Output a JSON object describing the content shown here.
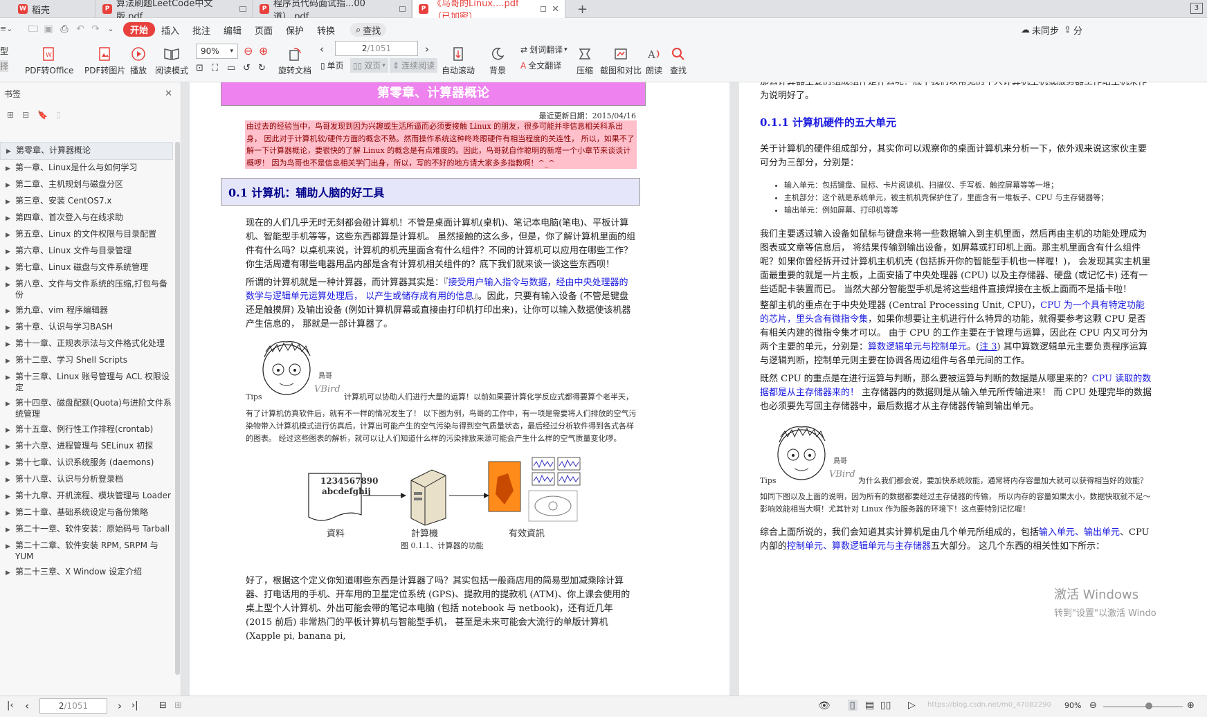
{
  "tabs": [
    {
      "label": "稻壳",
      "color": "#e8403c"
    },
    {
      "label": "算法刷题LeetCode中文版.pdf",
      "color": "#e8403c"
    },
    {
      "label": "程序员代码面试指...00道）.pdf",
      "color": "#e8403c"
    },
    {
      "label": "《鸟哥的Linux....pdf（已加密）",
      "color": "#e8403c"
    }
  ],
  "new_tab": "+",
  "menu": {
    "items": [
      "开始",
      "插入",
      "批注",
      "编辑",
      "页面",
      "保护",
      "转换"
    ],
    "search": "查找",
    "sync": "未同步",
    "share": "分"
  },
  "toolbar": {
    "left_labels": [
      "型",
      "择"
    ],
    "pdf_office": "PDF转Office",
    "pdf_image": "PDF转图片",
    "play": "播放",
    "read_mode": "阅读模式",
    "zoom": "90%",
    "rotate": "旋转文档",
    "page_current": "2",
    "page_total": "/1051",
    "single": "单页",
    "double": "双页",
    "continuous": "连续阅读",
    "autoscroll": "自动滚动",
    "background": "背景",
    "word_translate": "划词翻译",
    "full_translate": "全文翻译",
    "compress": "压缩",
    "screenshot": "截图和对比",
    "read_aloud": "朗读",
    "find": "查找"
  },
  "sidebar": {
    "title": "书签",
    "items": [
      "第零章、计算器概论",
      "第一章、Linux是什么与如何学习",
      "第二章、主机规划与磁盘分区",
      "第三章、安装 CentOS7.x",
      "第四章、首次登入与在线求助",
      "第五章、Linux 的文件权限与目录配置",
      "第六章、Linux 文件与目录管理",
      "第七章、Linux 磁盘与文件系统管理",
      "第八章、文件与文件系统的压缩,打包与备份",
      "第九章、vim 程序编辑器",
      "第十章、认识与学习BASH",
      "第十一章、正规表示法与文件格式化处理",
      "第十二章、学习 Shell Scripts",
      "第十三章、Linux 账号管理与 ACL 权限设定",
      "第十四章、磁盘配额(Quota)与进阶文件系统管理",
      "第十五章、例行性工作排程(crontab)",
      "第十六章、进程管理与 SELinux 初探",
      "第十七章、认识系统服务 (daemons)",
      "第十八章、认识与分析登录档",
      "第十九章、开机流程、模块管理与 Loader",
      "第二十章、基础系统设定与备份策略",
      "第二十一章、软件安装：原始码与 Tarball",
      "第二十二章、软件安装 RPM, SRPM 与 YUM",
      "第二十三章、X Window 设定介绍"
    ]
  },
  "page1": {
    "chapter_title": "第零章、计算器概论",
    "update_date": "最近更新日期：2015/04/16",
    "intro": "由过去的经验当中，鸟哥发现到因为兴趣或生活所逼而必须要接触 Linux 的朋友，很多可能并非信息相关科系出身， 因此对于计算机软/硬件方面的概念不熟。然而操作系统这种咚咚跟硬件有相当程度的关连性， 所以，如果不了解一下计算器概论，要很快的了解 Linux 的概念是有点难度的。因此，鸟哥就自作聪明的新增一个小章节来谈谈计概啰！ 因为鸟哥也不是信息相关学门出身，所以，写的不好的地方请大家多多指教啊！^_^",
    "section_title": "0.1  计算机：辅助人脑的好工具",
    "para1": "现在的人们几乎无时无刻都会碰计算机！不管是桌面计算机(桌机)、笔记本电脑(笔电)、平板计算机、智能型手机等等，这些东西都算是计算机。 虽然接触的这么多，但是，你了解计算机里面的组件有什么吗？以桌机来说，计算机的机壳里面含有什么组件？不同的计算机可以应用在哪些工作？ 你生活周遭有哪些电器用品内部是含有计算机相关组件的？底下我们就来谈一谈这些东西呗！",
    "para2_a": "所谓的计算机就是一种计算器，而计算器其实是：『",
    "para2_b": "接受用户输入指令与数据，经由中央处理器的数学与逻辑单元运算处理后， 以产生或储存成有用的信息",
    "para2_c": "』。因此，只要有输入设备 (不管是键盘还是触摸屏) 及输出设备 (例如计算机屏幕或直接由打印机打印出来)，让你可以输入数据使该机器产生信息的， 那就是一部计算器了。",
    "tips_label": "Tips",
    "tips_text_first": "计算机可以协助人们进行大量的运算！以前如果要计算化学反应式都得要算个老半天，",
    "tips_text_rest": "有了计算机仿真软件后，就有不一样的情况发生了！ 以下图为例，鸟哥的工作中，有一项是需要将人们排放的空气污染物带入计算机模式进行仿真后，计算出可能产生的空气污染与得到空气质量状态，最后经过分析软件得到各式各样的图表。 经过这些图表的解析，就可以让人们知道什么样的污染排放来源可能会产生什么样的空气质量变化啰。",
    "fig_input_text1": "1234567890",
    "fig_input_text2": "abcdefghij",
    "fig_label_data": "資料",
    "fig_label_computer": "計算機",
    "fig_label_info": "有效資訊",
    "fig_caption": "图 0.1.1、计算器的功能",
    "para3": "好了，根据这个定义你知道哪些东西是计算器了吗？其实包括一般商店用的简易型加减乘除计算器、打电话用的手机、开车用的卫星定位系统 (GPS)、提款用的提款机 (ATM)、你上课会使用的桌上型个人计算机、外出可能会带的笔记本电脑 (包括 notebook 与 netbook)，还有近几年 (2015 前后) 非常热门的平板计算机与智能型手机， 甚至是未来可能会大流行的单版计算机 (Xapple pi, banana pi,"
  },
  "page2": {
    "top_text": "那么计算器主要的组成组件是什么呢？底下我们以常见的个人计算机主机或服务器工作站主机来作为说明好了。",
    "section_title": "0.1.1  计算机硬件的五大单元",
    "para1": "关于计算机的硬件组成部分，其实你可以观察你的桌面计算机来分析一下，依外观来说这家伙主要可分为三部分，分别是：",
    "bullets": [
      "输入单元：包括键盘、鼠标、卡片阅读机、扫描仪、手写板、触控屏幕等等一堆；",
      "主机部分：这个就是系统单元，被主机机壳保护住了，里面含有一堆板子、CPU 与主存储器等；",
      "输出单元：例如屏幕、打印机等等"
    ],
    "para2": "我们主要透过输入设备如鼠标与键盘来将一些数据输入到主机里面，然后再由主机的功能处理成为图表或文章等信息后， 将结果传输到输出设备，如屏幕或打印机上面。那主机里面含有什么组件呢？如果你曾经拆开过计算机主机机壳 (包括拆开你的智能型手机也一样喔！)， 会发现其实主机里面最重要的就是一片主板，上面安插了中央处理器 (CPU) 以及主存储器、硬盘 (或记忆卡) 还有一些适配卡装置而已。 当然大部分智能型手机是将这些组件直接焊接在主板上面而不是插卡啦！",
    "para3_a": "整部主机的重点在于中央处理器 (Central Processing Unit, CPU)，",
    "para3_b": "CPU 为一个具有特定功能的芯片，里头含有微指令集",
    "para3_c": "，如果你想要让主机进行什么特异的功能，就得要参考这颗 CPU 是否有相关内建的微指令集才可以。 由于 CPU 的工作主要在于管理与运算，因此在 CPU 内又可分为两个主要的单元，分别是：",
    "para3_d": "算数逻辑单元与控制单元",
    "para3_e": "。(",
    "para3_f": "注 3",
    "para3_g": ") 其中算数逻辑单元主要负责程序运算与逻辑判断，控制单元则主要在协调各周边组件与各单元间的工作。",
    "para4_a": "既然 CPU 的重点是在进行运算与判断，那么要被运算与判断的数据是从哪里来的？",
    "para4_b": "CPU 读取的数据都是从主存储器来的！",
    "para4_c": " 主存储器内的数据则是从输入单元所传输进来！ 而 CPU 处理完毕的数据也必须要先写回主存储器中，最后数据才从主存储器传输到输出单元。",
    "tips_label": "Tips",
    "tips_text": "为什么我们都会说，要加快系统效能，通常将内存容量加大就可以获得相当好的效能？",
    "tips_text2": "如同下图以及上面的说明，因为所有的数据都要经过主存储器的传输， 所以内存的容量如果太小，数据快取就不足～影响效能相当大啊！尤其针对 Linux 作为服务器的环境下！这点要特别记忆喔！",
    "para5_a": "综合上面所说的，我们会知道其实计算机是由几个单元所组成的，包括",
    "para5_b": "输入单元、输出单元",
    "para5_c": "、CPU 内部的",
    "para5_d": "控制单元、算数逻辑单元与主存储器",
    "para5_e": "五大部分。 这几个东西的相关性如下所示："
  },
  "watermark": {
    "line1": "激活 Windows",
    "line2": "转到\"设置\"以激活 Windo"
  },
  "status": {
    "page_current": "2",
    "page_total": "/1051",
    "zoom": "90%",
    "url_fragment": "https://blog.csdn.net/m0_47082290"
  },
  "colors": {
    "accent": "#e8403c",
    "chapter_bg": "#ee82ee",
    "intro_bg": "#ffc0cb",
    "intro_text": "#8b0000",
    "section_bg": "#e6e6fa",
    "section_text": "#00008b",
    "link_blue": "#1a1ae0"
  }
}
